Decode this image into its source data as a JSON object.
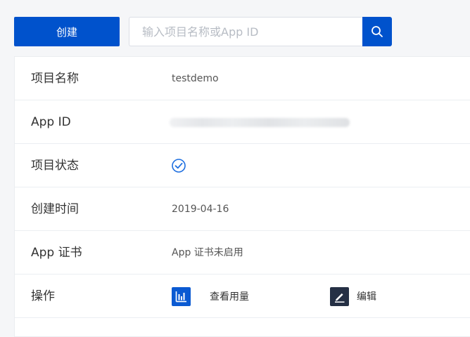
{
  "toolbar": {
    "create_label": "创建",
    "search_placeholder": "输入项目名称或App ID",
    "search_value": ""
  },
  "details": {
    "project_name": {
      "label": "项目名称",
      "value": "testdemo"
    },
    "app_id": {
      "label": "App ID"
    },
    "project_status": {
      "label": "项目状态",
      "icon": "check-circle-icon",
      "color": "#1e6fe0"
    },
    "created_time": {
      "label": "创建时间",
      "value": "2019-04-16"
    },
    "certificate": {
      "label": "App 证书",
      "value": "App 证书未启用"
    },
    "operations": {
      "label": "操作",
      "usage": {
        "label": "查看用量",
        "icon": "bar-chart-icon"
      },
      "edit": {
        "label": "编辑",
        "icon": "pencil-icon"
      }
    }
  },
  "colors": {
    "primary": "#0052cc",
    "edit_icon_bg": "#253045",
    "usage_icon_bg": "#0a5ad2"
  }
}
